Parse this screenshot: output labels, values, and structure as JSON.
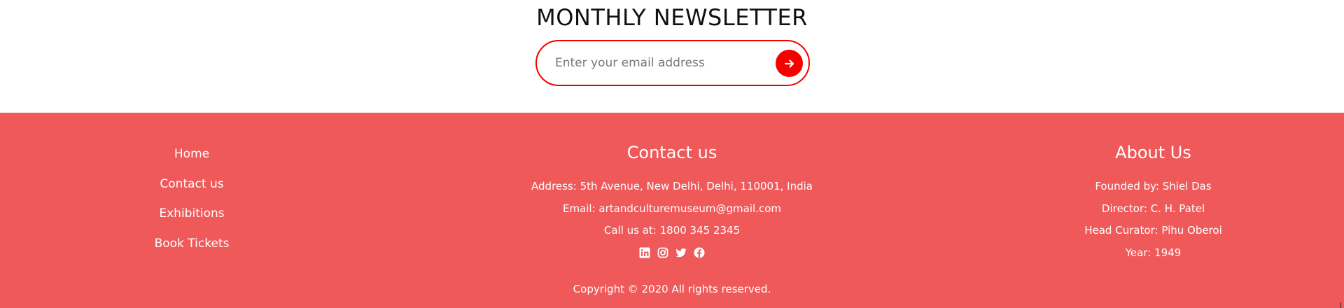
{
  "newsletter": {
    "title": "MONTHLY NEWSLETTER",
    "email_placeholder": "Enter your email address",
    "submit_icon": "arrow-right-icon"
  },
  "footer": {
    "nav": [
      {
        "label": "Home"
      },
      {
        "label": "Contact us"
      },
      {
        "label": "Exhibitions"
      },
      {
        "label": "Book Tickets"
      }
    ],
    "contact": {
      "heading": "Contact us",
      "address": "Address: 5th Avenue, New Delhi, Delhi, 110001, India",
      "email": "Email: artandculturemuseum@gmail.com",
      "phone": "Call us at: 1800 345 2345",
      "social_icons": [
        "linkedin-icon",
        "instagram-icon",
        "twitter-icon",
        "facebook-icon"
      ]
    },
    "about": {
      "heading": "About Us",
      "founded": "Founded by: Shiel Das",
      "director": "Director: C. H. Patel",
      "curator": "Head Curator: Pihu Oberoi",
      "year": "Year: 1949"
    },
    "copyright": "Copyright © 2020 All rights reserved."
  },
  "colors": {
    "accent": "#f40000",
    "footer_bg": "#f05959",
    "text_light": "#ffffff"
  }
}
